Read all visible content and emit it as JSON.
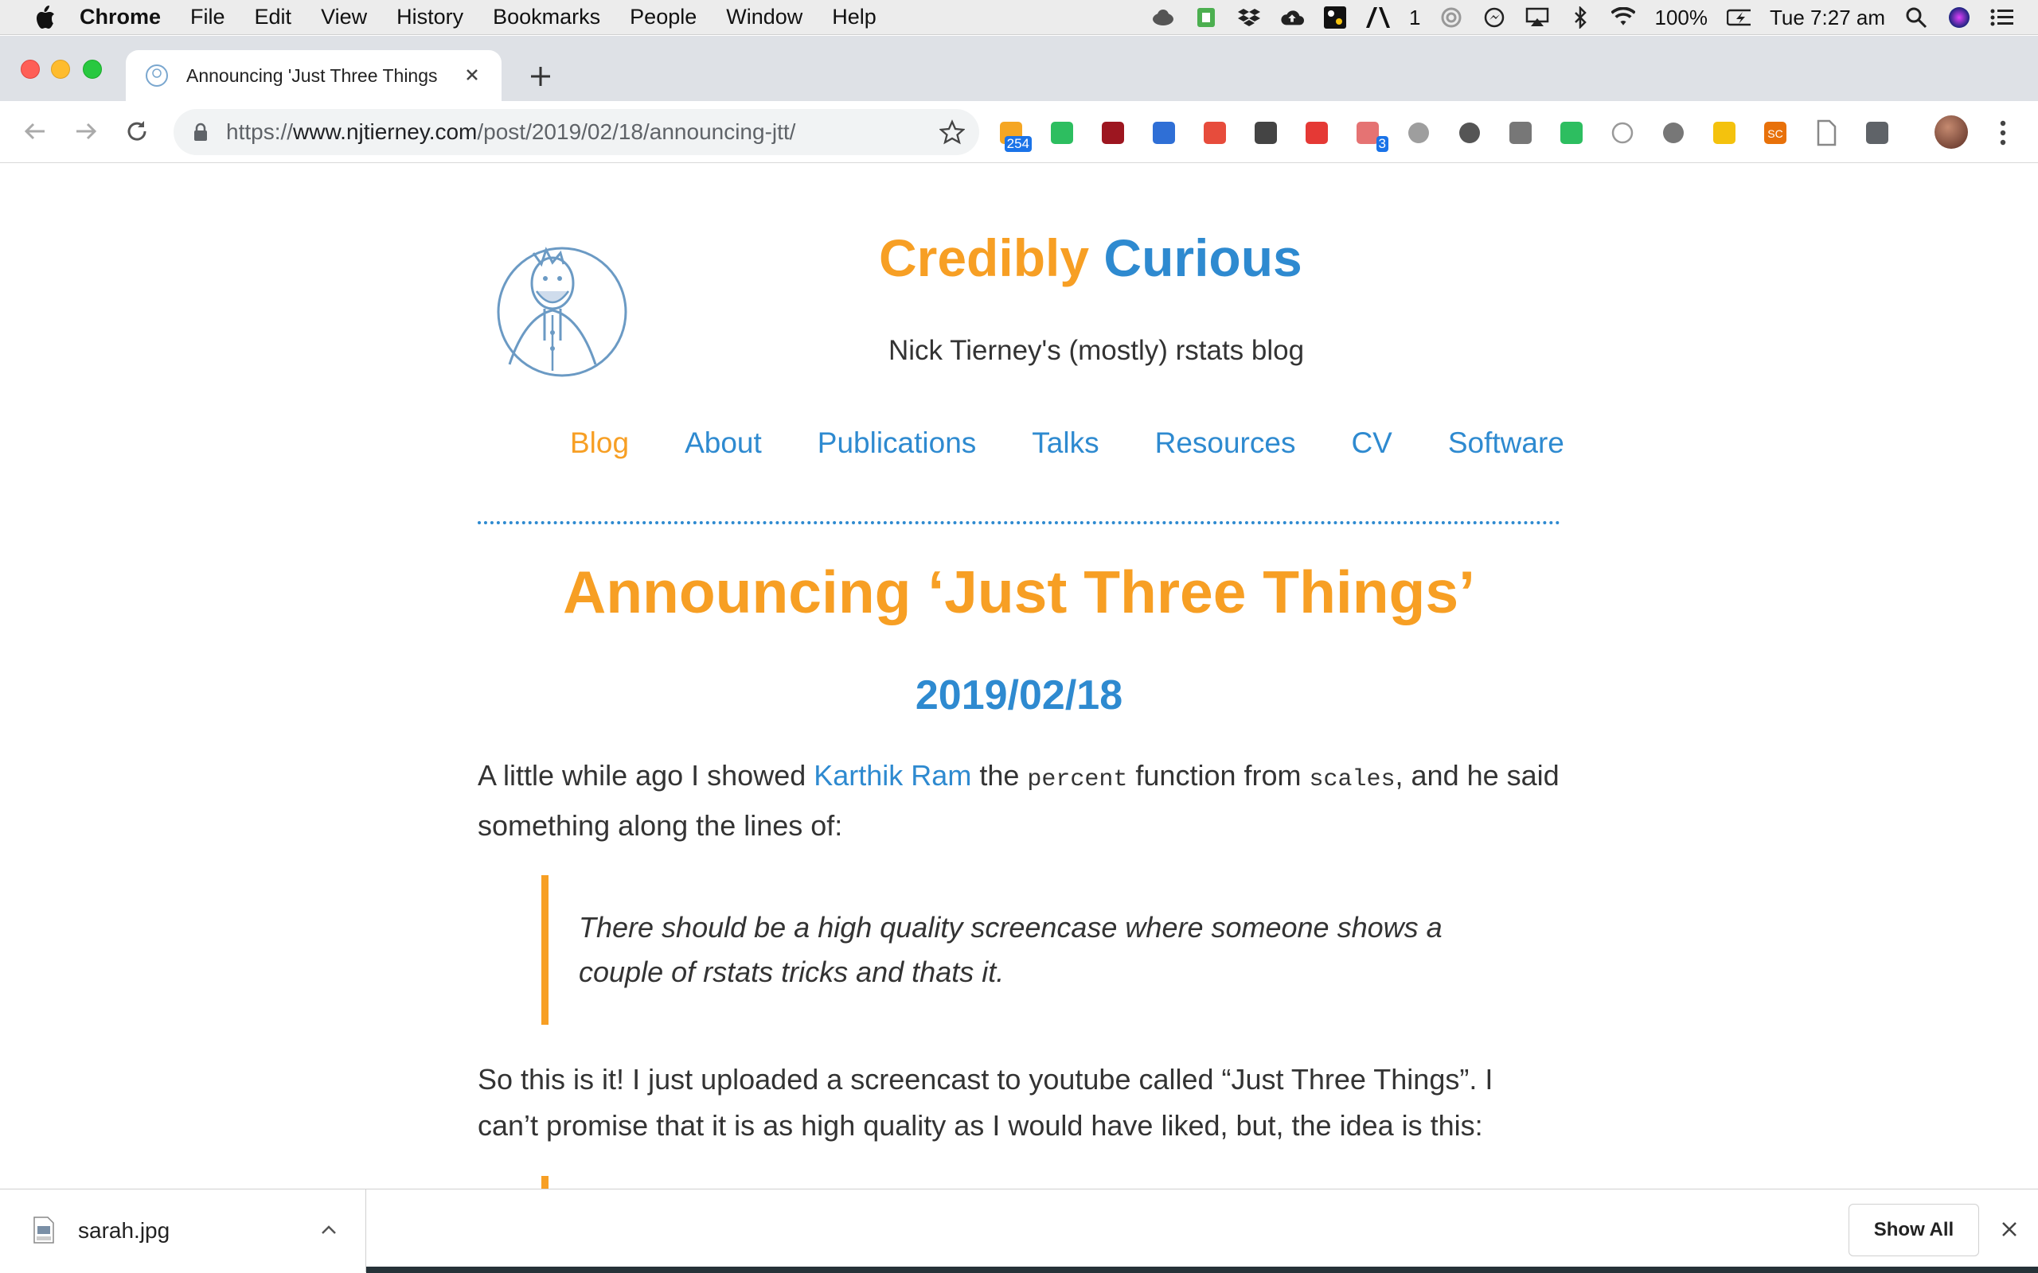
{
  "menubar": {
    "app_name": "Chrome",
    "items": [
      "File",
      "Edit",
      "View",
      "History",
      "Bookmarks",
      "People",
      "Window",
      "Help"
    ],
    "battery": "100%",
    "adobe_count": "1",
    "clock": "Tue 7:27 am"
  },
  "tab": {
    "title": "Announcing 'Just Three Things"
  },
  "toolbar": {
    "url_prefix": "https://",
    "url_host": "www.njtierney.com",
    "url_path": "/post/2019/02/18/announcing-jtt/",
    "extensions": [
      {
        "icon": "rss-feed-icon",
        "badge": "254",
        "color": "#f5a623"
      },
      {
        "icon": "evernote-icon",
        "color": "#2dbe60"
      },
      {
        "icon": "mendeley-icon",
        "color": "#9d1620"
      },
      {
        "icon": "zotero-icon",
        "color": "#2f6fd6"
      },
      {
        "icon": "rainbow-icon",
        "color": "#e74c3c"
      },
      {
        "icon": "lightbulb-icon",
        "color": "#444444"
      },
      {
        "icon": "shield-icon",
        "color": "#e53935"
      },
      {
        "icon": "flow-icon",
        "badge": "3",
        "color": "#e57373"
      },
      {
        "icon": "drive-icon",
        "color": "#9e9e9e"
      },
      {
        "icon": "sphere-icon",
        "color": "#555555"
      },
      {
        "icon": "chat-bubble-icon",
        "color": "#777777"
      },
      {
        "icon": "face-icon",
        "color": "#2dbe60"
      },
      {
        "icon": "circle-outline-icon",
        "color": "#999999"
      },
      {
        "icon": "bar-chart-icon",
        "color": "#777777"
      },
      {
        "icon": "dots-icon",
        "color": "#f4c20d"
      },
      {
        "icon": "sc-icon",
        "text": "SC",
        "color": "#e8710a"
      },
      {
        "icon": "page-icon",
        "color": "#888888"
      },
      {
        "icon": "satellite-icon",
        "color": "#5f6368"
      }
    ]
  },
  "site": {
    "title_part1": "Credibly",
    "title_part2": "Curious",
    "subtitle": "Nick Tierney's (mostly) rstats blog",
    "nav": [
      {
        "label": "Blog",
        "active": true
      },
      {
        "label": "About"
      },
      {
        "label": "Publications"
      },
      {
        "label": "Talks"
      },
      {
        "label": "Resources"
      },
      {
        "label": "CV"
      },
      {
        "label": "Software"
      }
    ]
  },
  "post": {
    "title": "Announcing ‘Just Three Things’",
    "date": "2019/02/18",
    "p1_a": "A little while ago I showed ",
    "p1_link": "Karthik Ram",
    "p1_b": " the ",
    "p1_code1": "percent",
    "p1_c": " function from ",
    "p1_code2": "scales",
    "p1_d": ", and he said something along the lines of:",
    "quote": "There should be a high quality screencase where someone shows a couple of rstats tricks and thats it.",
    "p2": "So this is it! I just uploaded a screencast to youtube called “Just Three Things”. I can’t promise that it is as high quality as I would have liked, but, the idea is this:"
  },
  "downloads": {
    "file_name": "sarah.jpg",
    "show_all": "Show All"
  },
  "colors": {
    "accent_orange": "#f79f24",
    "accent_blue": "#2e8ad0"
  }
}
